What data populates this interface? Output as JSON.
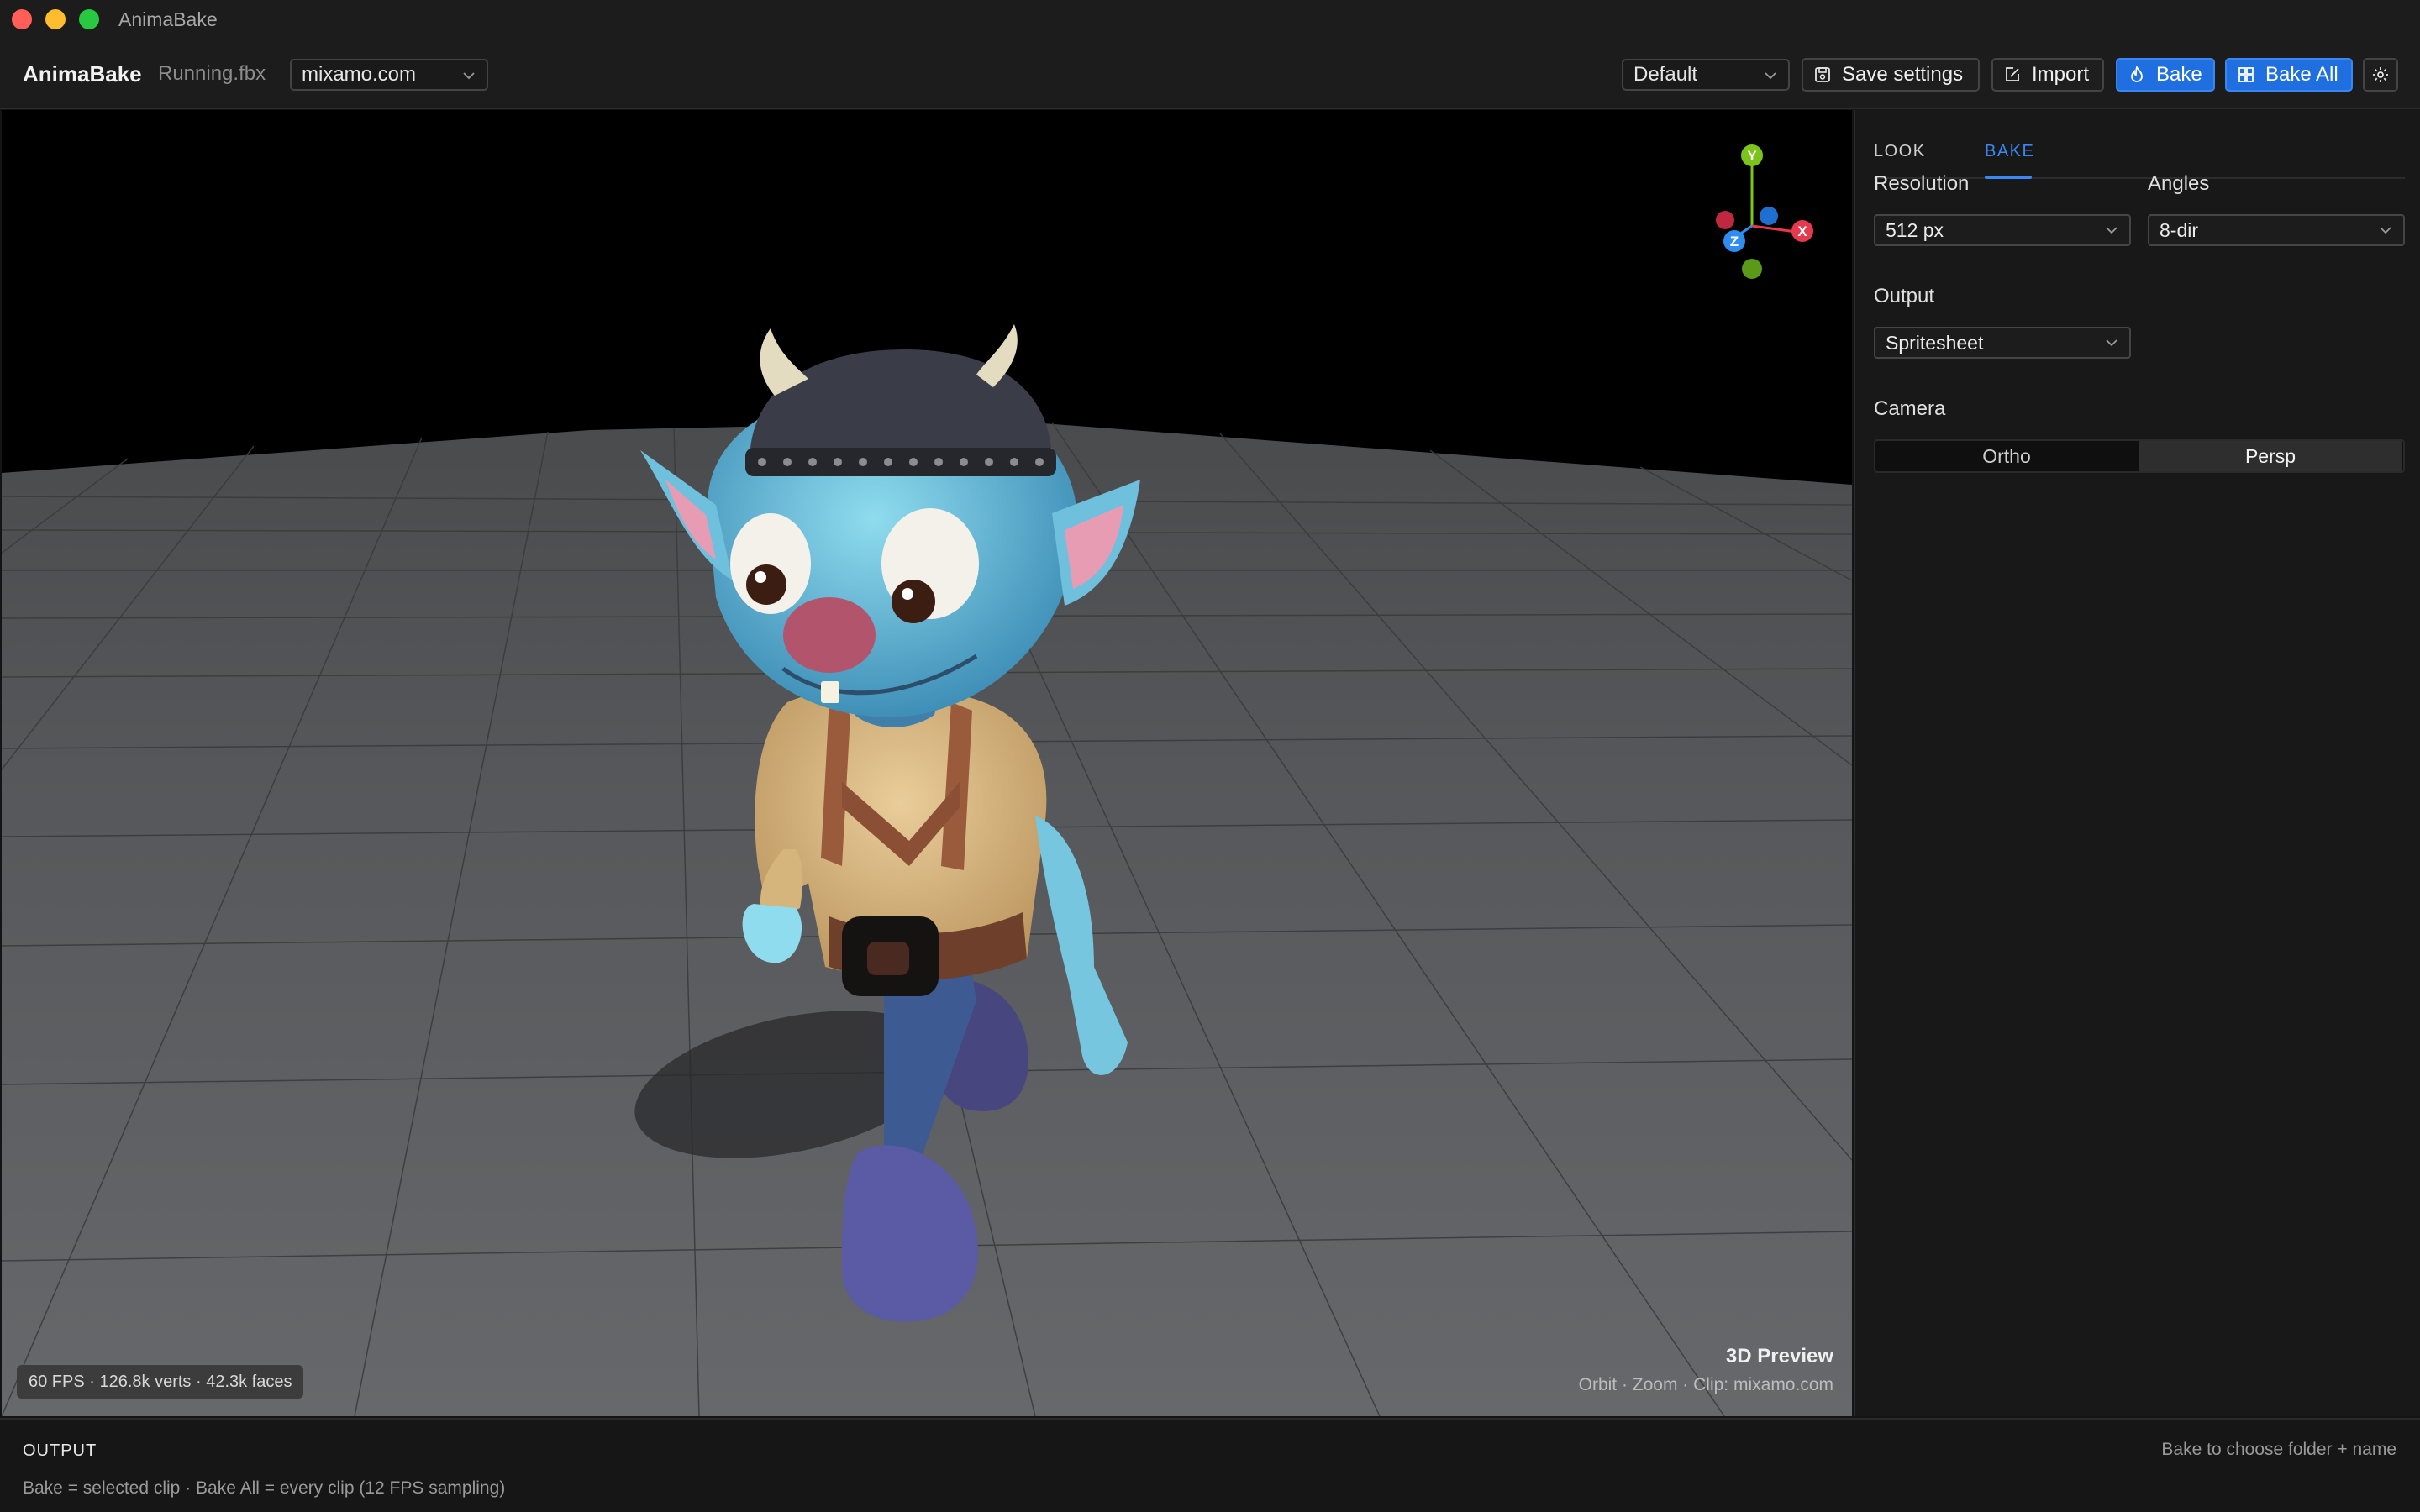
{
  "window": {
    "title": "AnimaBake"
  },
  "toolbar": {
    "app_name": "AnimaBake",
    "file_name": "Running.fbx",
    "clip_source": "mixamo.com",
    "preset": "Default",
    "save_settings_label": "Save settings",
    "import_label": "Import",
    "bake_label": "Bake",
    "bake_all_label": "Bake All"
  },
  "viewport": {
    "stats": "60 FPS · 126.8k verts · 42.3k faces",
    "title": "3D Preview",
    "subtitle": "Orbit · Zoom · Clip: mixamo.com",
    "gizmo": {
      "y": "Y",
      "x": "X",
      "z": "Z"
    }
  },
  "panel": {
    "tabs": [
      "LOOK",
      "BAKE"
    ],
    "active_tab": "BAKE",
    "resolution": {
      "label": "Resolution",
      "value": "512 px"
    },
    "angles": {
      "label": "Angles",
      "value": "8-dir"
    },
    "output": {
      "label": "Output",
      "value": "Spritesheet"
    },
    "camera": {
      "label": "Camera",
      "options": [
        "Ortho",
        "Persp"
      ],
      "selected": "Persp"
    }
  },
  "output_bar": {
    "title": "OUTPUT",
    "hint": "Bake to choose folder + name",
    "text": "Bake = selected clip · Bake All = every clip (12 FPS sampling)"
  },
  "colors": {
    "accent": "#1f6fe0",
    "axis_x": "#e5394f",
    "axis_y": "#7cc41c",
    "axis_z": "#2f8cf0"
  }
}
